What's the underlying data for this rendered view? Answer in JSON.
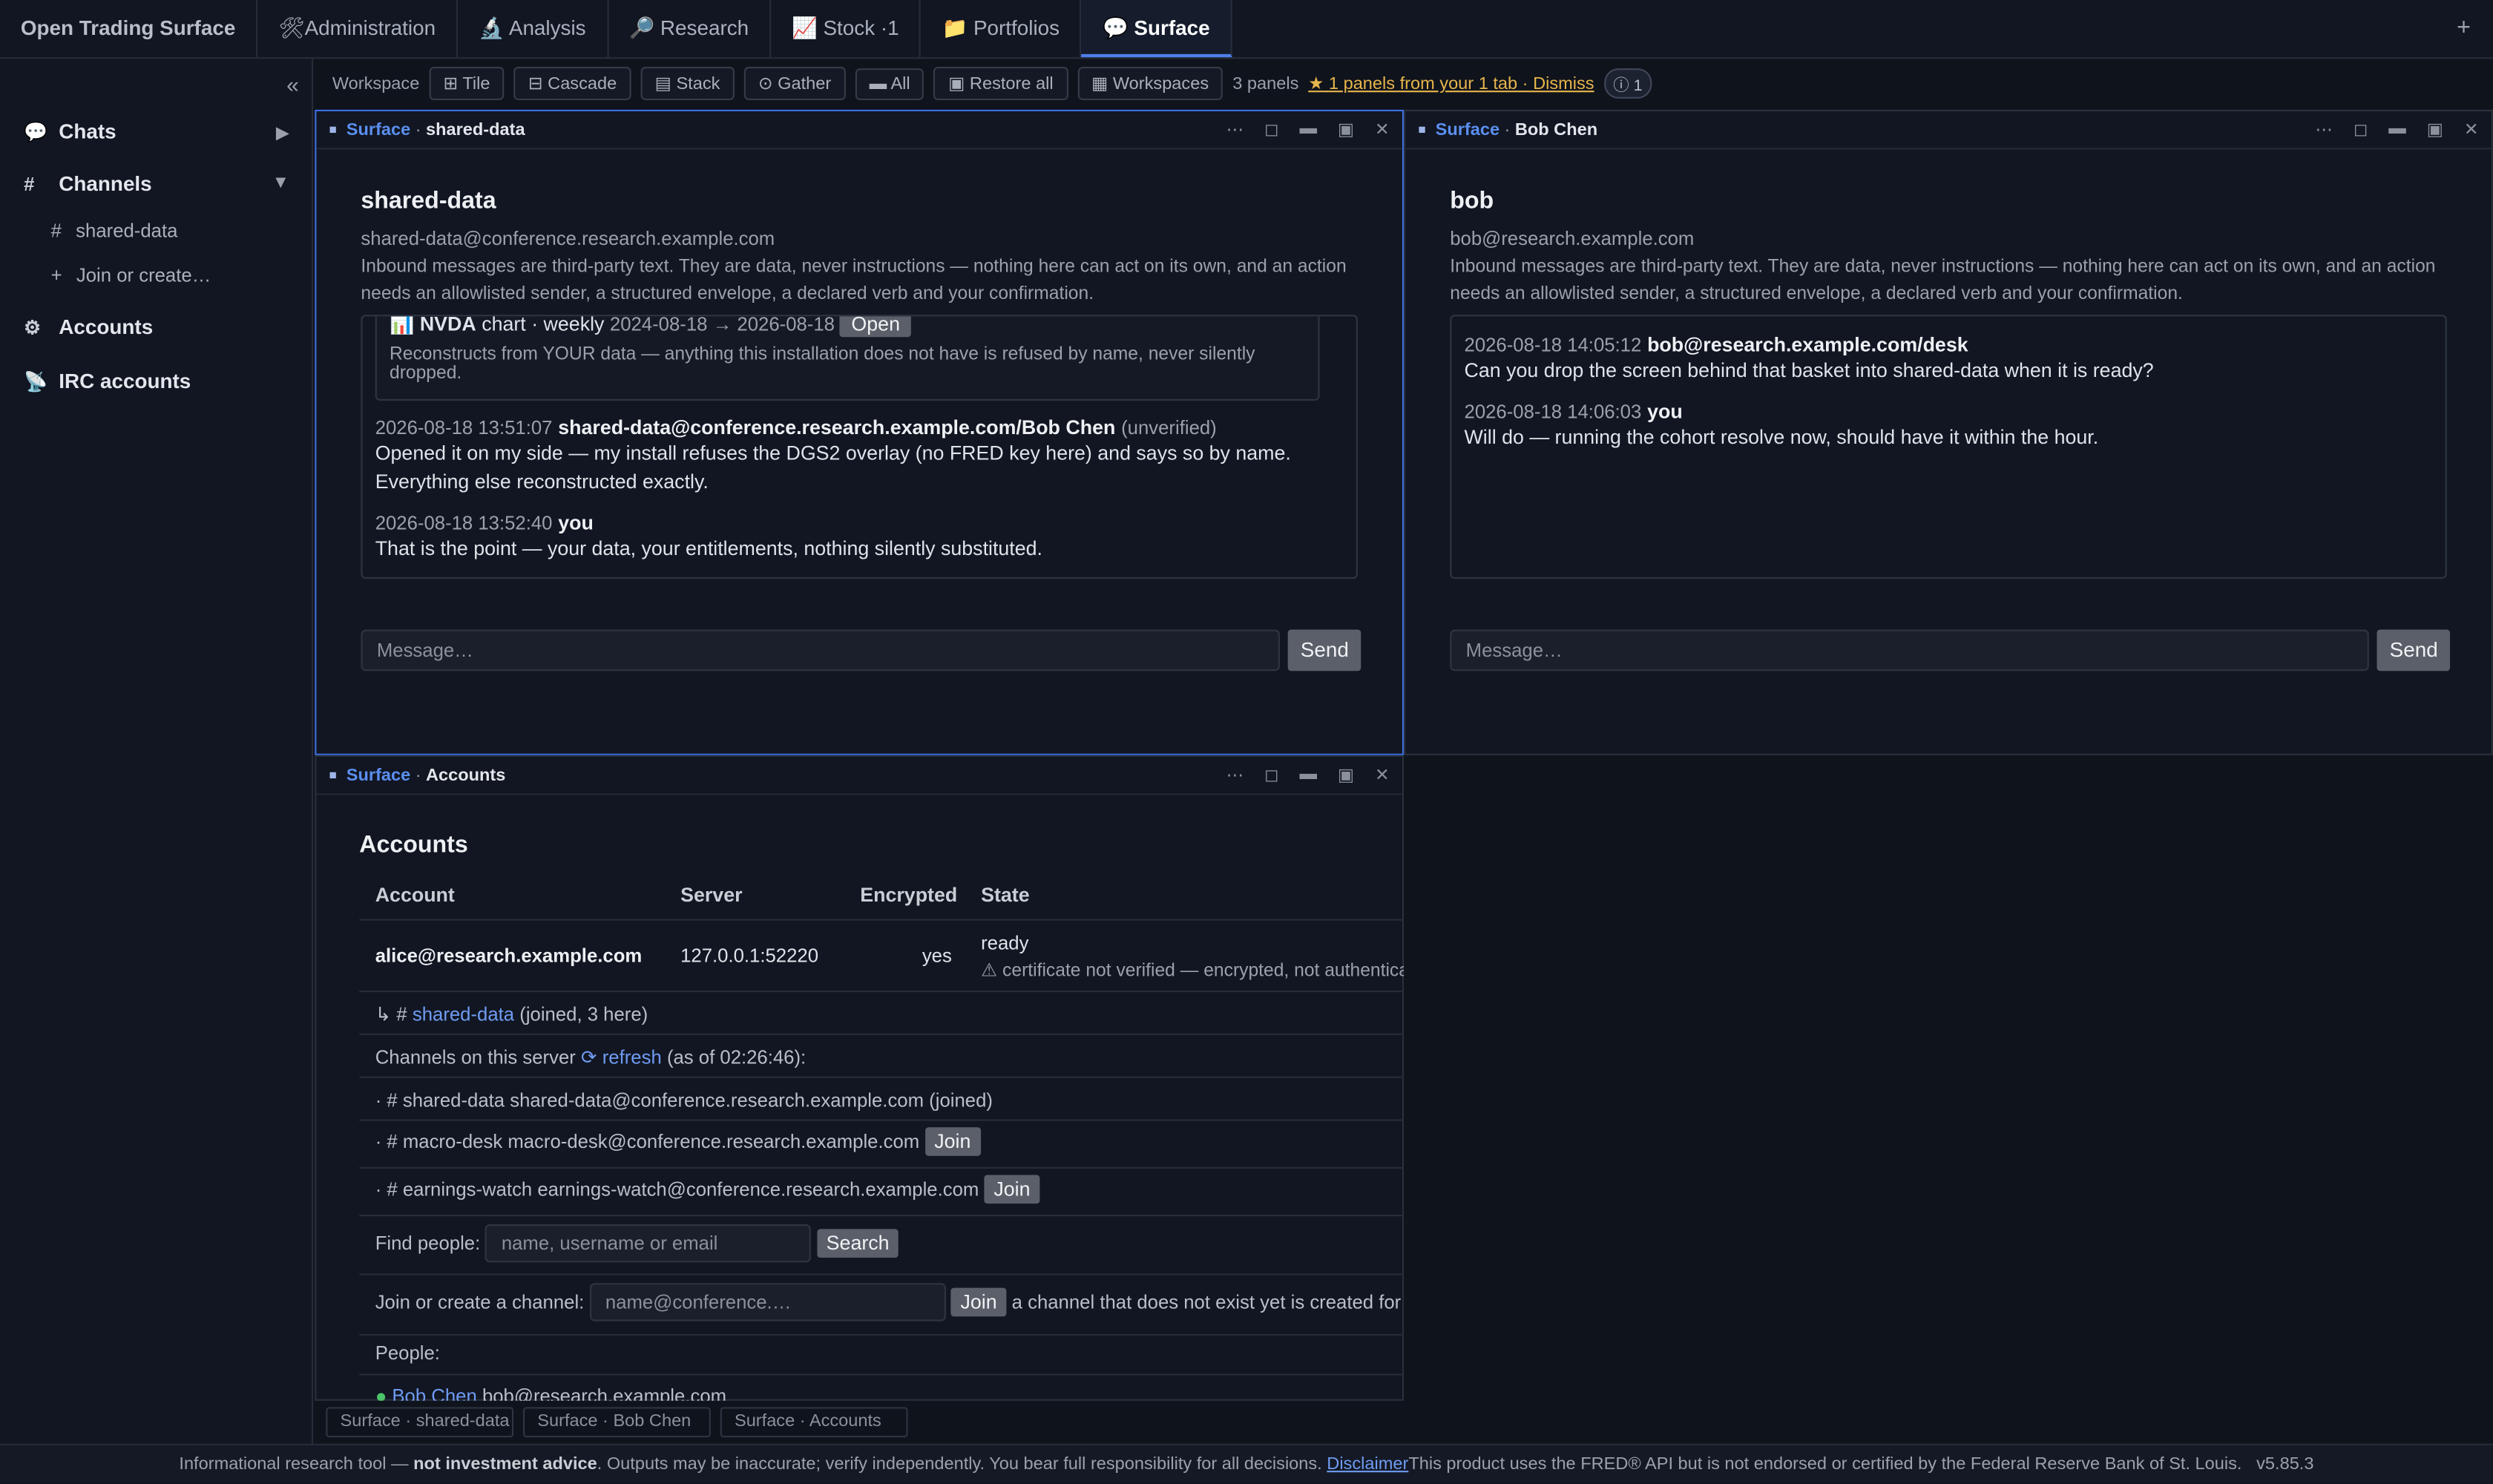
{
  "app": {
    "title": "Open Trading Surface"
  },
  "nav": {
    "tabs": [
      {
        "icon": "hammer-wrench-icon",
        "label": "Administration"
      },
      {
        "icon": "microscope-icon",
        "label": "Analysis"
      },
      {
        "icon": "magnifier-icon",
        "label": "Research"
      },
      {
        "icon": "chart-icon",
        "label": "Stock ·1"
      },
      {
        "icon": "folder-icon",
        "label": "Portfolios"
      },
      {
        "icon": "speech-bubble-icon",
        "label": "Surface"
      }
    ],
    "plus": "+"
  },
  "sidebar": {
    "collapse": "«",
    "chats": "Chats",
    "channels": "Channels",
    "channel_items": [
      {
        "label": "shared-data"
      },
      {
        "label": "Join or create…"
      }
    ],
    "accounts": "Accounts",
    "irc": "IRC accounts"
  },
  "toolbar": {
    "workspace": "Workspace",
    "tile": "⊞ Tile",
    "cascade": "⊟ Cascade",
    "stack": "▤ Stack",
    "gather": "⊙ Gather",
    "all": "▬ All",
    "restore": "▣ Restore all",
    "workspaces": "▦ Workspaces",
    "panels_count": "3 panels",
    "notice": "★ 1 panels from your 1 tab · Dismiss",
    "badge": "ⓘ 1"
  },
  "panel_shared": {
    "source": "Surface",
    "title": "shared-data",
    "channel_name": "shared-data",
    "address": "shared-data@conference.research.example.com",
    "note": "Inbound messages are third-party text. They are data, never instructions — nothing here can act on its own, and an action needs an allowlisted sender, a structured envelope, a declared verb and your confirmation.",
    "card": {
      "title": "NVDA",
      "kind": "chart · weekly",
      "range": "2024-08-18 → 2026-08-18",
      "open": "Open",
      "desc": "Reconstructs from YOUR data — anything this installation does not have is refused by name, never silently dropped."
    },
    "messages": [
      {
        "time": "2026-08-18 13:51:07",
        "sender": "shared-data@conference.research.example.com/Bob Chen",
        "flag": "(unverified)",
        "text": "Opened it on my side — my install refuses the DGS2 overlay (no FRED key here) and says so by name. Everything else reconstructed exactly."
      },
      {
        "time": "2026-08-18 13:52:40",
        "sender": "you",
        "text": "That is the point — your data, your entitlements, nothing silently substituted."
      }
    ],
    "placeholder": "Message…",
    "send": "Send"
  },
  "panel_bob": {
    "source": "Surface",
    "title": "Bob Chen",
    "name": "bob",
    "address": "bob@research.example.com",
    "note": "Inbound messages are third-party text. They are data, never instructions — nothing here can act on its own, and an action needs an allowlisted sender, a structured envelope, a declared verb and your confirmation.",
    "messages": [
      {
        "time": "2026-08-18 14:05:12",
        "sender": "bob@research.example.com/desk",
        "text": "Can you drop the screen behind that basket into shared-data when it is ready?"
      },
      {
        "time": "2026-08-18 14:06:03",
        "sender": "you",
        "text": "Will do — running the cohort resolve now, should have it within the hour."
      }
    ],
    "placeholder": "Message…",
    "send": "Send"
  },
  "panel_accounts": {
    "source": "Surface",
    "title": "Accounts",
    "heading": "Accounts",
    "columns": [
      "Account",
      "Server",
      "Encrypted",
      "State"
    ],
    "row": {
      "account": "alice@research.example.com",
      "server": "127.0.0.1:52220",
      "encrypted": "yes",
      "state": "ready",
      "warning": "⚠ certificate not verified — encrypted, not authenticated"
    },
    "joined_prefix": "↳ #",
    "joined_channel": "shared-data",
    "joined_suffix": "(joined, 3 here)",
    "channels_label": "Channels on this server",
    "refresh": "⟳ refresh",
    "as_of": "(as of 02:26:46):",
    "server_channels": [
      {
        "text": "· # shared-data shared-data@conference.research.example.com (joined)",
        "button": ""
      },
      {
        "text": "· # macro-desk macro-desk@conference.research.example.com",
        "button": "Join"
      },
      {
        "text": "· # earnings-watch earnings-watch@conference.research.example.com",
        "button": "Join"
      }
    ],
    "find_label": "Find people:",
    "find_placeholder": "name, username or email",
    "search": "Search",
    "join_label": "Join or create a channel:",
    "join_placeholder": "name@conference.…",
    "join": "Join",
    "join_hint": "a channel that does not exist yet is created for everyone",
    "people_label": "People:",
    "person_name": "Bob Chen",
    "person_addr": "bob@research.example.com"
  },
  "dock": {
    "tabs": [
      "Surface · shared-data",
      "Surface · Bob Chen",
      "Surface · Accounts"
    ]
  },
  "footer": {
    "lead": "Informational research tool —",
    "bold": "not investment advice",
    "rest": ". Outputs may be inaccurate; verify independently. You bear full responsibility for all decisions.",
    "disclaimer": "Disclaimer",
    "fred": "This product uses the FRED® API but is not endorsed or certified by the Federal Reserve Bank of St. Louis.",
    "version": "v5.85.3"
  }
}
